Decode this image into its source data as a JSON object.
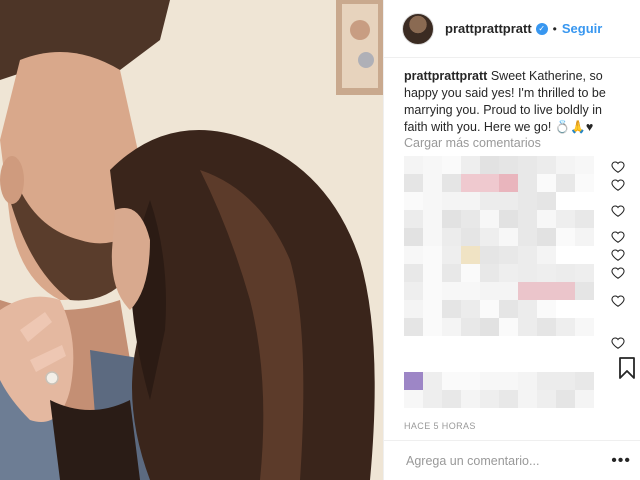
{
  "post": {
    "username": "prattprattpratt",
    "verified_badge": "verified-check-icon",
    "follow_label": "Seguir",
    "separator": "•",
    "caption_text": "Sweet Katherine, so happy you said yes! I'm thrilled to be marrying you. Proud to live boldly in faith with you. Here we go! 💍🙏♥",
    "load_more_label": "Cargar más comentarios",
    "timestamp": "HACE 5 HORAS",
    "comment_placeholder": "Agrega un comentario...",
    "more_options": "•••"
  },
  "icons": {
    "like": "heart-outline-icon",
    "save": "bookmark-icon",
    "verified": "verified-check-icon"
  },
  "colors": {
    "link_blue": "#3897f0",
    "muted_text": "#999999",
    "border": "#efefef"
  }
}
